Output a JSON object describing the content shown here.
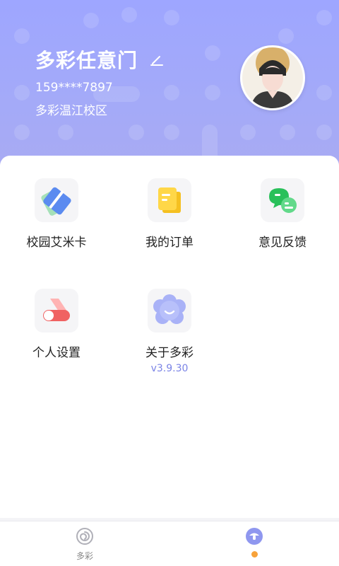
{
  "profile": {
    "name": "多彩任意门",
    "phone": "159****7897",
    "campus": "多彩温江校区"
  },
  "grid": {
    "campus_card": {
      "label": "校园艾米卡",
      "icon": "card-icon"
    },
    "my_orders": {
      "label": "我的订单",
      "icon": "document-icon"
    },
    "feedback": {
      "label": "意见反馈",
      "icon": "chat-bubble-icon"
    },
    "settings": {
      "label": "个人设置",
      "icon": "toggle-icon"
    },
    "about": {
      "label": "关于多彩",
      "icon": "flower-smile-icon",
      "version": "v3.9.30"
    }
  },
  "tabbar": {
    "home": {
      "label": "多彩",
      "icon": "spiral-icon"
    },
    "mine": {
      "label": "",
      "icon": "mushroom-icon",
      "badge_color": "#f7a23a"
    }
  },
  "colors": {
    "header_gradient_start": "#9ea6ff",
    "accent": "#7b84e6"
  }
}
